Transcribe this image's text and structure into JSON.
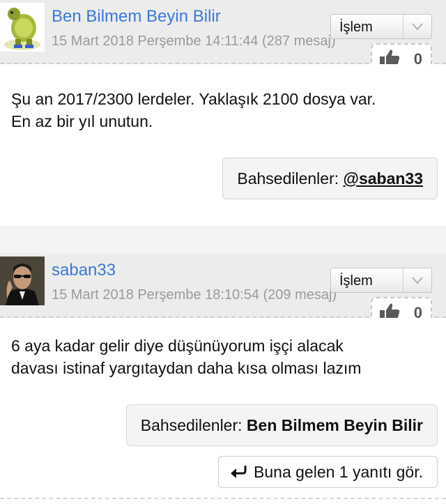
{
  "posts": [
    {
      "username": "Ben Bilmem Beyin Bilir",
      "timestamp": "15 Mart 2018 Perşembe 14:11:44 (287 mesaj)",
      "action_label": "İşlem",
      "like_count": "0",
      "text_lines": [
        "Şu an 2017/2300 lerdeler. Yaklaşık 2100 dosya var.",
        "En az bir yıl unutun."
      ],
      "mentions_label": "Bahsedilenler:",
      "mentions_value": "@saban33"
    },
    {
      "username": "saban33",
      "timestamp": "15 Mart 2018 Perşembe 18:10:54 (209 mesaj)",
      "action_label": "İşlem",
      "like_count": "0",
      "text_lines": [
        "6 aya kadar gelir diye düşünüyorum işçi alacak",
        "davası istinaf yargıtaydan daha kısa olması lazım"
      ],
      "mentions_label": "Bahsedilenler:",
      "mentions_value": "Ben Bilmem Beyin Bilir",
      "replies_label": "Buna gelen 1 yanıtı gör."
    }
  ],
  "colors": {
    "username": "#3a78d8",
    "timestamp": "#9a9a9a",
    "header_bg": "#ececec"
  }
}
